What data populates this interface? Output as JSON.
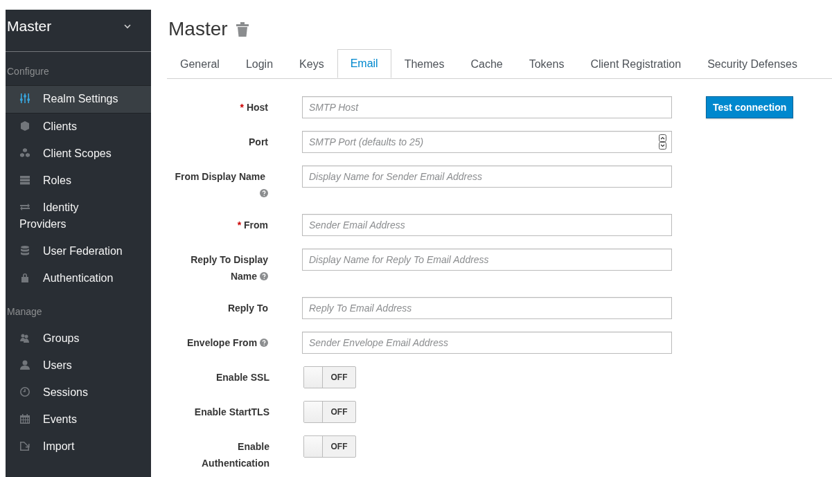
{
  "realm_selector": {
    "label": "Master"
  },
  "sidebar": {
    "sections": [
      {
        "heading": "Configure",
        "items": [
          {
            "label": "Realm Settings",
            "selected": true
          },
          {
            "label": "Clients",
            "selected": false
          },
          {
            "label": "Client Scopes",
            "selected": false
          },
          {
            "label": "Roles",
            "selected": false
          },
          {
            "label": "Identity Providers",
            "selected": false
          },
          {
            "label": "User Federation",
            "selected": false
          },
          {
            "label": "Authentication",
            "selected": false
          }
        ]
      },
      {
        "heading": "Manage",
        "items": [
          {
            "label": "Groups",
            "selected": false
          },
          {
            "label": "Users",
            "selected": false
          },
          {
            "label": "Sessions",
            "selected": false
          },
          {
            "label": "Events",
            "selected": false
          },
          {
            "label": "Import",
            "selected": false
          }
        ]
      }
    ]
  },
  "page": {
    "title": "Master"
  },
  "tabs": [
    {
      "label": "General",
      "selected": false
    },
    {
      "label": "Login",
      "selected": false
    },
    {
      "label": "Keys",
      "selected": false
    },
    {
      "label": "Email",
      "selected": true
    },
    {
      "label": "Themes",
      "selected": false
    },
    {
      "label": "Cache",
      "selected": false
    },
    {
      "label": "Tokens",
      "selected": false
    },
    {
      "label": "Client Registration",
      "selected": false
    },
    {
      "label": "Security Defenses",
      "selected": false
    }
  ],
  "form": {
    "required_mark": "*",
    "fields": [
      {
        "kind": "text",
        "label": "Host",
        "required": true,
        "help": false,
        "placeholder": "SMTP Host"
      },
      {
        "kind": "number",
        "label": "Port",
        "required": false,
        "help": false,
        "placeholder": "SMTP Port (defaults to 25)"
      },
      {
        "kind": "text",
        "label": "From Display Name",
        "required": false,
        "help": true,
        "placeholder": "Display Name for Sender Email Address"
      },
      {
        "kind": "text",
        "label": "From",
        "required": true,
        "help": false,
        "placeholder": "Sender Email Address"
      },
      {
        "kind": "text",
        "label": "Reply To Display Name",
        "required": false,
        "help": true,
        "placeholder": "Display Name for Reply To Email Address"
      },
      {
        "kind": "text",
        "label": "Reply To",
        "required": false,
        "help": false,
        "placeholder": "Reply To Email Address"
      },
      {
        "kind": "text",
        "label": "Envelope From",
        "required": false,
        "help": true,
        "placeholder": "Sender Envelope Email Address"
      },
      {
        "kind": "switch",
        "label": "Enable SSL",
        "required": false,
        "help": false,
        "on": false,
        "state_label": "OFF"
      },
      {
        "kind": "switch",
        "label": "Enable StartTLS",
        "required": false,
        "help": false,
        "on": false,
        "state_label": "OFF"
      },
      {
        "kind": "switch",
        "label": "Enable Authentication",
        "required": false,
        "help": false,
        "on": false,
        "state_label": "OFF"
      }
    ],
    "test_button": "Test connection"
  }
}
